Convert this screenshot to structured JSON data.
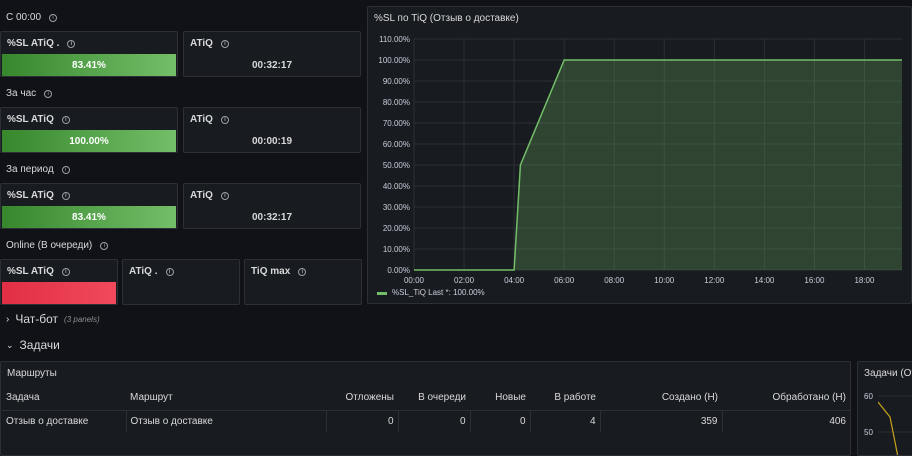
{
  "sections": [
    {
      "title": "С 00:00",
      "sl_label": "%SL ATiQ .",
      "sl_value": "83.41%",
      "atiq_label": "ATiQ",
      "atiq_value": "00:32:17"
    },
    {
      "title": "За час",
      "sl_label": "%SL ATiQ",
      "sl_value": "100.00%",
      "atiq_label": "ATiQ",
      "atiq_value": "00:00:19"
    },
    {
      "title": "За период",
      "sl_label": "%SL ATiQ",
      "sl_value": "83.41%",
      "atiq_label": "ATiQ",
      "atiq_value": "00:32:17"
    }
  ],
  "online": {
    "title": "Online (В очереди)",
    "sl_label": "%SL ATiQ",
    "atiq_label": "ATiQ .",
    "tiq_label": "TiQ max"
  },
  "chart_panel": {
    "title": "%SL по TiQ (Отзыв о доставке)",
    "legend": "%SL_TiQ  Last *: 100.00%"
  },
  "chart_data": {
    "type": "area",
    "x": [
      "00:00",
      "02:00",
      "04:00",
      "04:15",
      "06:00",
      "08:00",
      "10:00",
      "12:00",
      "14:00",
      "16:00",
      "18:00",
      "19:30"
    ],
    "series": [
      {
        "name": "%SL_TiQ",
        "values": [
          0,
          0,
          0,
          50,
          100,
          100,
          100,
          100,
          100,
          100,
          100,
          100
        ]
      }
    ],
    "x_ticks": [
      "00:00",
      "02:00",
      "04:00",
      "06:00",
      "08:00",
      "10:00",
      "12:00",
      "14:00",
      "16:00",
      "18:00"
    ],
    "y_ticks": [
      "0.00%",
      "10.00%",
      "20.00%",
      "30.00%",
      "40.00%",
      "50.00%",
      "60.00%",
      "70.00%",
      "80.00%",
      "90.00%",
      "100.00%",
      "110.00%"
    ],
    "ylim": [
      0,
      110
    ],
    "grid": true,
    "color": "#73bf69"
  },
  "rows": {
    "chatbot": {
      "label": "Чат-бот",
      "sub": "(3 panels)"
    },
    "tasks": {
      "label": "Задачи"
    }
  },
  "table": {
    "title": "Маршруты",
    "headers": [
      "Задача",
      "Маршрут",
      "Отложены",
      "В очереди",
      "Новые",
      "В работе",
      "Создано (Н)",
      "Обработано (Н)"
    ],
    "rows": [
      [
        "Отзыв о доставке",
        "Отзыв о доставке",
        "0",
        "0",
        "0",
        "4",
        "359",
        "406"
      ]
    ]
  },
  "mini_panel": {
    "title": "Задачи (От",
    "y_ticks": [
      "60",
      "50"
    ]
  }
}
